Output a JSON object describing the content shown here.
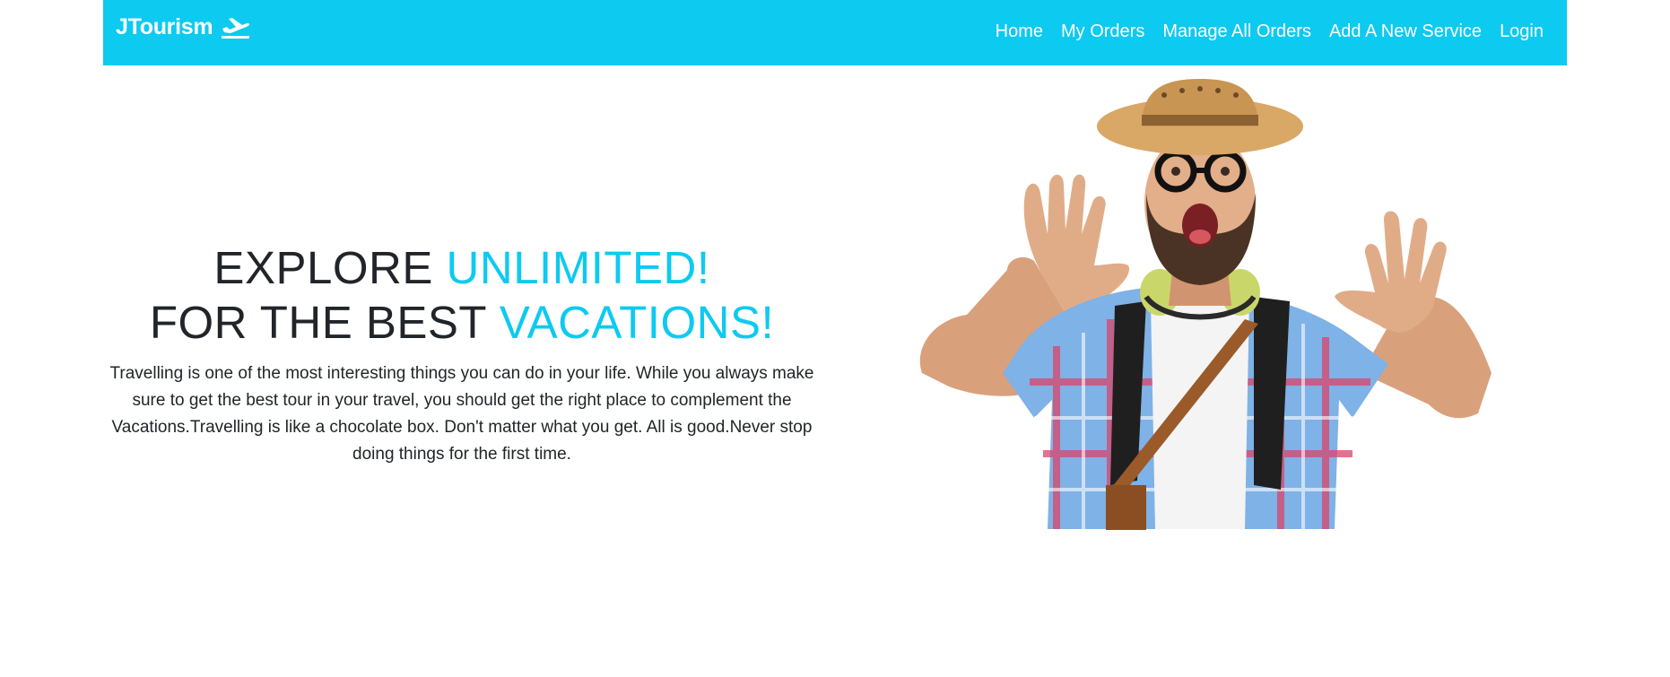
{
  "navbar": {
    "brand": "JTourism",
    "brand_icon": "airplane-icon",
    "background": "#0dcaf0",
    "links": [
      "Home",
      "My Orders",
      "Manage All Orders",
      "Add A New Service",
      "Login"
    ]
  },
  "hero": {
    "line1_dark": "EXPLORE ",
    "line1_accent": "UNLIMITED!",
    "line2_dark": "FOR THE BEST ",
    "line2_accent": "VACATIONS!",
    "accent_color": "#0dcaf0",
    "description": "Travelling is one of the most interesting things you can do in your life. While you always make sure to get the best tour in your travel, you should get the right place to complement the Vacations.Travelling is like a chocolate box. Don't matter what you get. All is good.Never stop doing things for the first time."
  }
}
